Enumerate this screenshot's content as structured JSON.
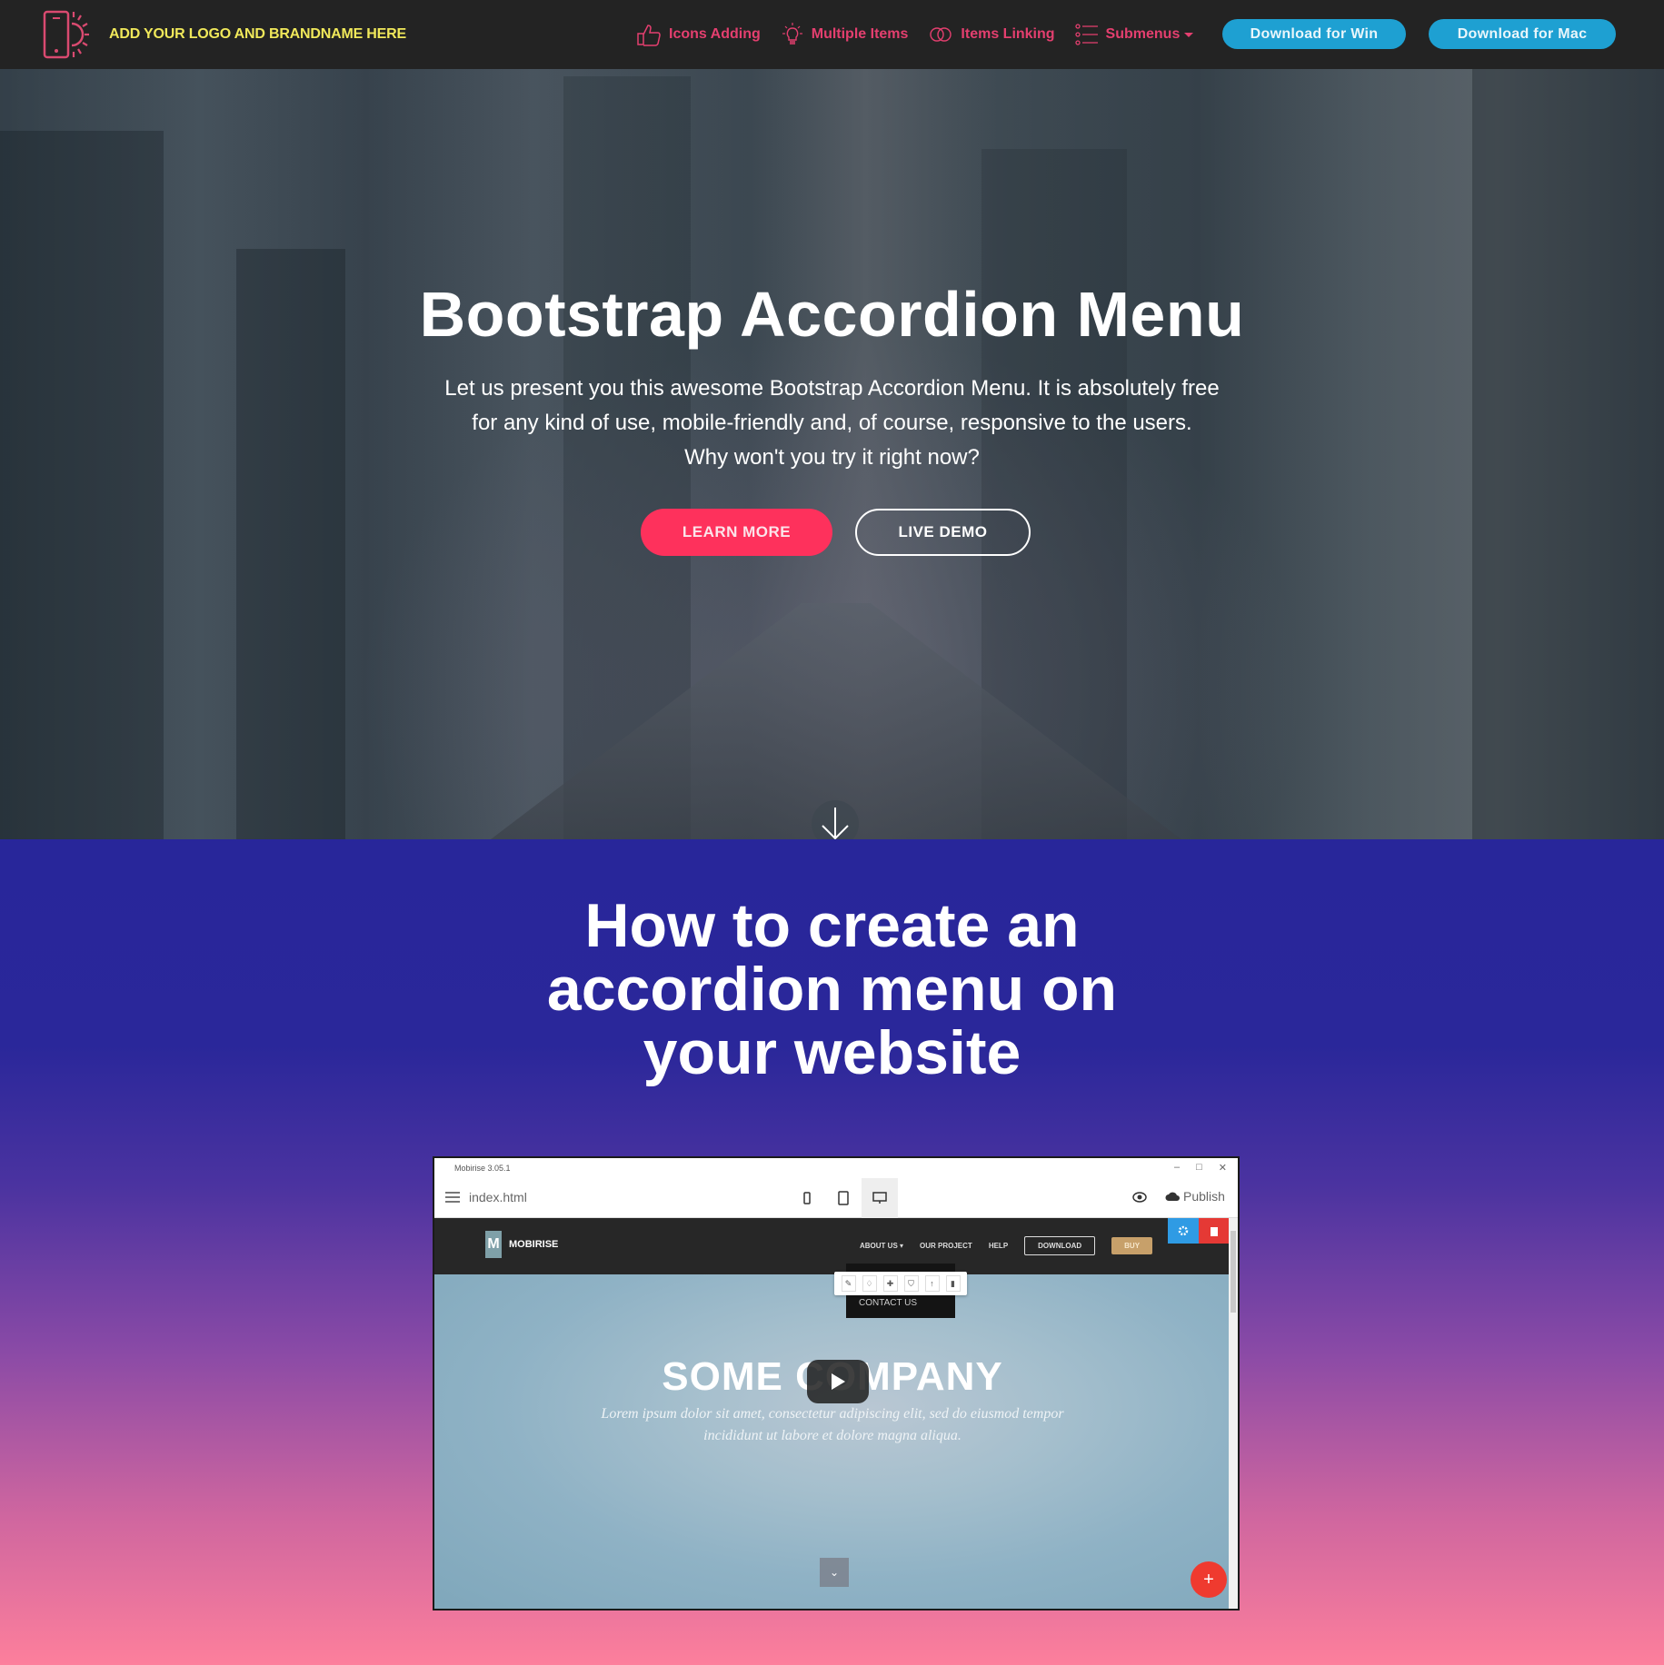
{
  "navbar": {
    "brand_name": "ADD YOUR LOGO AND BRANDNAME HERE",
    "brand_icon": "phone-sun-logo-icon",
    "items": [
      {
        "label": "Icons Adding",
        "icon": "thumbs-up-icon"
      },
      {
        "label": "Multiple Items",
        "icon": "lightbulb-icon"
      },
      {
        "label": "Items Linking",
        "icon": "link-icon"
      },
      {
        "label": "Submenus",
        "icon": "list-icon",
        "has_dropdown": true
      }
    ],
    "download_win": "Download for Win",
    "download_mac": "Download for Mac",
    "colors": {
      "background": "#232323",
      "brand": "#f0e85a",
      "link": "#e43f6f",
      "button": "#1ea0d2"
    }
  },
  "hero": {
    "title": "Bootstrap Accordion Menu",
    "text_lines": [
      "Let us present you this awesome Bootstrap Accordion Menu. It is absolutely free",
      "for any kind of use, mobile-friendly and, of course, responsive to the users.",
      "Why won't you try it right now?"
    ],
    "learn_more": "LEARN MORE",
    "live_demo": "LIVE DEMO",
    "scroll_icon": "arrow-down-icon",
    "colors": {
      "primary_button": "#fe315c"
    }
  },
  "section2": {
    "title_lines": [
      "How to create an",
      "accordion menu on",
      "your website"
    ],
    "video": {
      "window_title": "Mobirise 3.05.1",
      "file_name": "index.html",
      "publish_label": "Publish",
      "site_brand": "MOBIRISE",
      "site_links": [
        "ABOUT US ▾",
        "OUR PROJECT",
        "HELP"
      ],
      "site_download": "DOWNLOAD",
      "site_buy": "BUY",
      "dropdown_item": "CONTACT US",
      "company": "SOME COMPANY",
      "lorem_lines": [
        "Lorem ipsum dolor sit amet, consectetur adipiscing elit, sed do eiusmod tempor",
        "incididunt ut labore et dolore magna aliqua."
      ],
      "editbar_icons": [
        "✎",
        "♢",
        "✚",
        "⛉",
        "↑",
        "▮"
      ]
    }
  }
}
